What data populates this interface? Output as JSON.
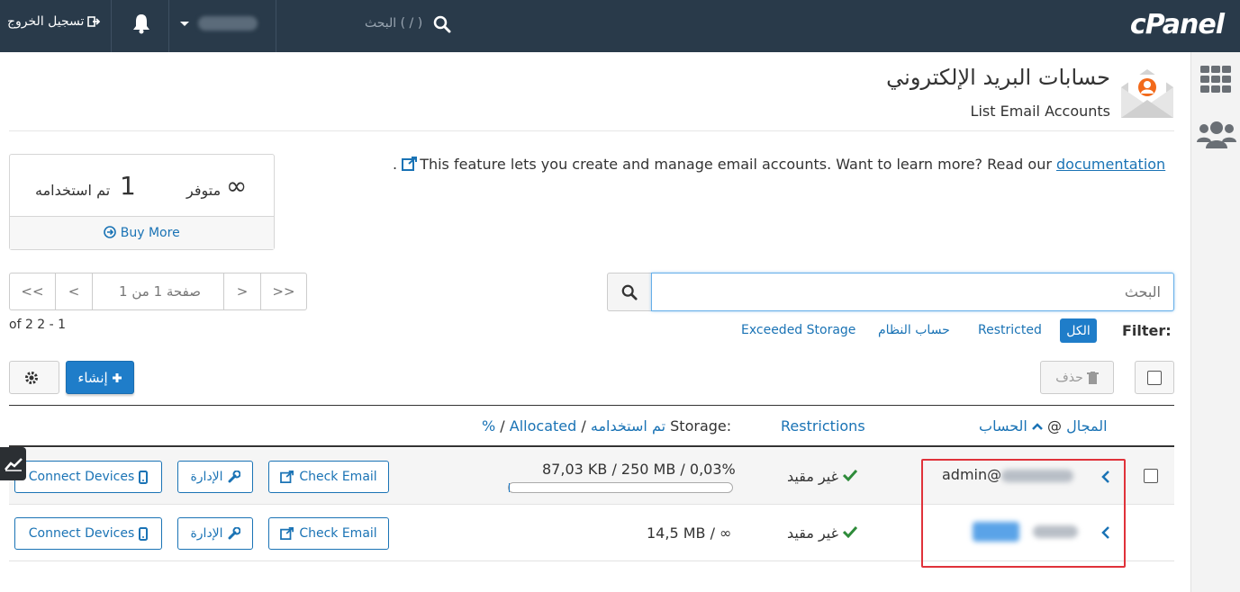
{
  "topbar": {
    "logout_label": "تسجيل الخروج",
    "search_placeholder": "البحث ( / )",
    "logo": "cPanel"
  },
  "header": {
    "title": "حسابات البريد الإلكتروني",
    "subtitle": "List Email Accounts"
  },
  "intro": {
    "text": "This feature lets you create and manage email accounts. Want to learn more? Read our ",
    "link": "documentation",
    "suffix": "."
  },
  "stats": {
    "available_value": "∞",
    "available_label": "متوفر",
    "used_value": "1",
    "used_label": "تم استخدامه",
    "buy_more": "Buy More"
  },
  "pager": {
    "first": "<<",
    "prev": "<",
    "page_label": "صفحة 1 من 1",
    "next": ">",
    "last": ">>",
    "info": "of 2 2 - 1"
  },
  "search": {
    "placeholder": "البحث"
  },
  "filter": {
    "label": "Filter:",
    "all": "الكل",
    "restricted": "Restricted",
    "system": "حساب النظام",
    "exceeded": "Exceeded Storage"
  },
  "actions": {
    "create": "إنشاء",
    "delete": "حذف"
  },
  "table": {
    "col_account": "الحساب",
    "col_at": "@",
    "col_domain": "المجال",
    "col_restrictions": "Restrictions",
    "col_storage_prefix": "Storage:",
    "col_storage_used": "تم استخدامه",
    "col_storage_allocated": "Allocated",
    "col_storage_percent": "%",
    "rows": [
      {
        "account": "admin@",
        "restriction": "غير مقيد",
        "storage": "87,03 KB / 250 MB / 0,03%",
        "usage_percent": 0.03,
        "check_email": "Check Email",
        "manage": "الإدارة",
        "connect": "Connect Devices"
      },
      {
        "account": "",
        "restriction": "غير مقيد",
        "storage": "14,5 MB / ∞",
        "check_email": "Check Email",
        "manage": "الإدارة",
        "connect": "Connect Devices"
      }
    ]
  },
  "colors": {
    "topbar": "#293a4a",
    "accent": "#1f7dc9",
    "link": "#1a73b5",
    "success": "#2e8b3a",
    "highlight": "#e0323a"
  }
}
